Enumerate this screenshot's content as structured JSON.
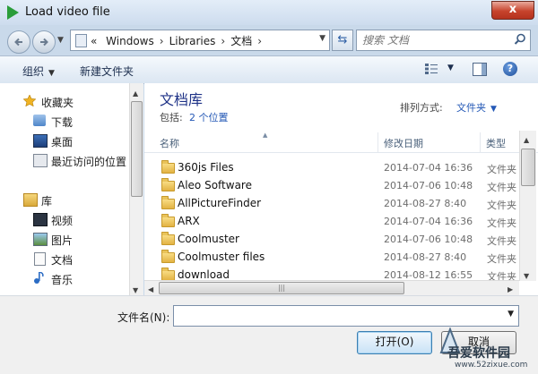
{
  "window": {
    "title": "Load video file",
    "close_label": "x"
  },
  "address": {
    "overflow": "«",
    "crumbs": [
      "Windows",
      "Libraries",
      "文档"
    ],
    "search_placeholder": "搜索 文档"
  },
  "toolbar": {
    "organize": "组织",
    "new_folder": "新建文件夹"
  },
  "nav": {
    "favorites_header": "收藏夹",
    "favorites": [
      "下载",
      "桌面",
      "最近访问的位置"
    ],
    "libraries_header": "库",
    "libraries": [
      "视频",
      "图片",
      "文档",
      "音乐"
    ]
  },
  "library": {
    "title": "文档库",
    "includes_label": "包括:",
    "includes_link": "2 个位置",
    "arrange_label": "排列方式:",
    "arrange_value": "文件夹"
  },
  "columns": {
    "name": "名称",
    "date": "修改日期",
    "type": "类型"
  },
  "files": [
    {
      "name": "360js Files",
      "date": "2014-07-04 16:36",
      "type": "文件夹"
    },
    {
      "name": "Aleo Software",
      "date": "2014-07-06 10:48",
      "type": "文件夹"
    },
    {
      "name": "AllPictureFinder",
      "date": "2014-08-27 8:40",
      "type": "文件夹"
    },
    {
      "name": "ARX",
      "date": "2014-07-04 16:36",
      "type": "文件夹"
    },
    {
      "name": "Coolmuster",
      "date": "2014-07-06 10:48",
      "type": "文件夹"
    },
    {
      "name": "Coolmuster files",
      "date": "2014-08-27 8:40",
      "type": "文件夹"
    },
    {
      "name": "download",
      "date": "2014-08-12 16:55",
      "type": "文件夹"
    }
  ],
  "filename": {
    "label": "文件名(N):",
    "value": ""
  },
  "buttons": {
    "open": "打开(O)",
    "cancel": "取消"
  },
  "watermark": {
    "text": "吾爱软件园",
    "url": "www.52zixue.com"
  },
  "colors": {
    "link": "#2458b6",
    "library_title": "#1e3287",
    "folder": "#e3b343",
    "close": "#c7432c"
  }
}
